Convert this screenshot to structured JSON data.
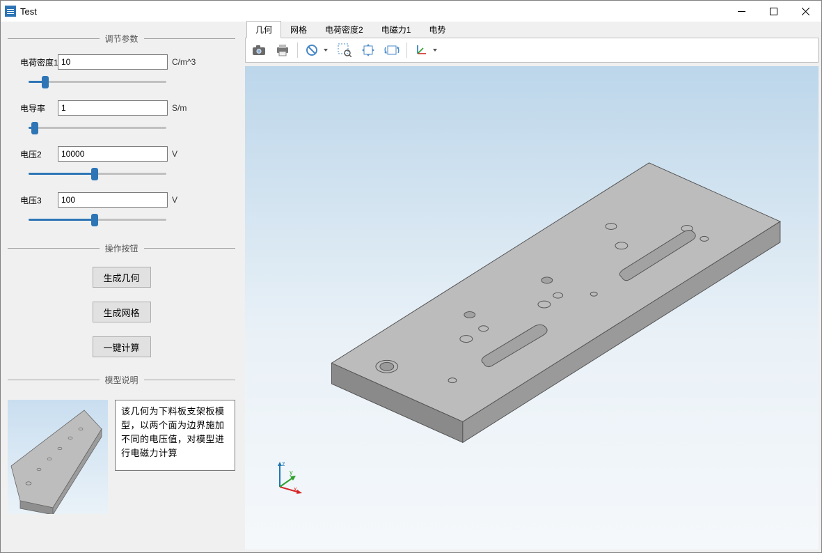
{
  "window": {
    "title": "Test"
  },
  "sidebar": {
    "groups": {
      "params": "调节参数",
      "ops": "操作按钮",
      "desc": "模型说明"
    },
    "params": [
      {
        "label": "电荷密度1",
        "value": "10",
        "unit": "C/m^3",
        "slider": 10
      },
      {
        "label": "电导率",
        "value": "1",
        "unit": "S/m",
        "slider": 2
      },
      {
        "label": "电压2",
        "value": "10000",
        "unit": "V",
        "slider": 48
      },
      {
        "label": "电压3",
        "value": "100",
        "unit": "V",
        "slider": 48
      }
    ],
    "buttons": {
      "geom": "生成几何",
      "mesh": "生成网格",
      "calc": "一键计算"
    },
    "description": "该几何为下料板支架板模型，以两个面为边界施加不同的电压值，对模型进行电磁力计算"
  },
  "main": {
    "tabs": [
      "几何",
      "网格",
      "电荷密度2",
      "电磁力1",
      "电势"
    ],
    "active_tab": 0,
    "toolbar": {
      "icons": [
        "camera-icon",
        "print-icon",
        "reset-icon",
        "zoom-box-icon",
        "pan-icon",
        "rotate-icon",
        "axes-icon"
      ]
    },
    "axes_labels": {
      "x": "x",
      "y": "y",
      "z": "z"
    }
  },
  "colors": {
    "accent": "#2e75b6",
    "axis_x": "#d62728",
    "axis_y": "#2ca02c",
    "axis_z": "#1f77b4"
  }
}
